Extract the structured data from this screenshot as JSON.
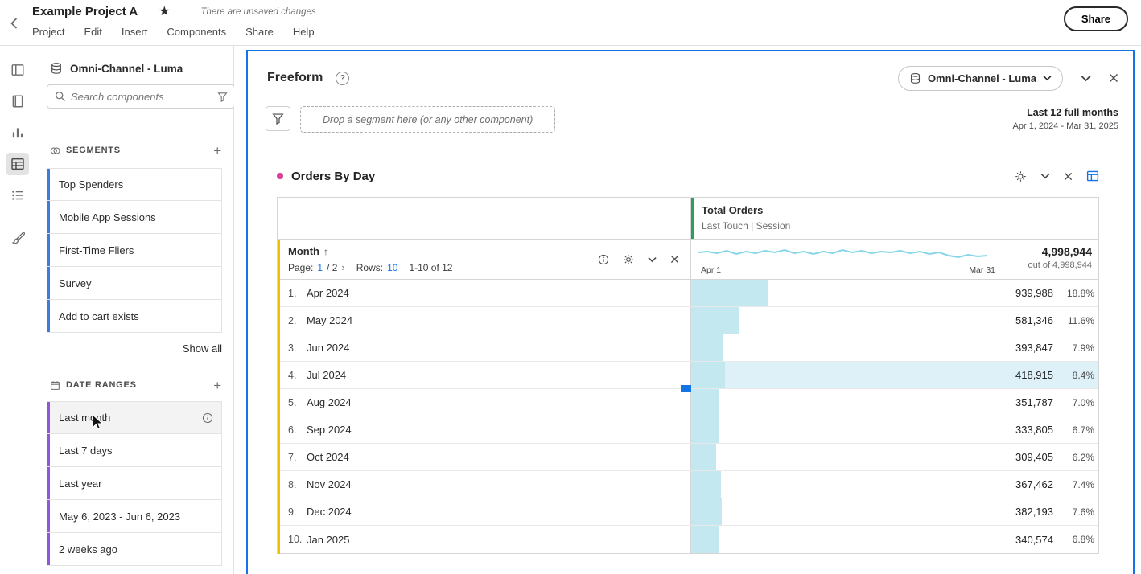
{
  "colors": {
    "accent_blue": "#1473e6",
    "segment": "#3c7dd9",
    "date_range": "#9256d9",
    "dimension": "#efc100",
    "metric": "#2aa05e",
    "bar": "#c3e8ef",
    "row_highlight": "#def0f8",
    "spark": "#86d6e6",
    "viz_dot": "#da3f9b"
  },
  "topbar": {
    "title": "Example Project A",
    "unsaved_notice": "There are unsaved changes",
    "menus": [
      "Project",
      "Edit",
      "Insert",
      "Components",
      "Share",
      "Help"
    ],
    "share_label": "Share"
  },
  "rail_icons": [
    "panels-icon",
    "components-book-icon",
    "visualizations-chart-icon",
    "freeform-table-icon",
    "components-list-icon",
    "design-brush-icon"
  ],
  "sidebar": {
    "dataset_name": "Omni-Channel - Luma",
    "search_placeholder": "Search components",
    "segments_label": "SEGMENTS",
    "segments": [
      "Top Spenders",
      "Mobile App Sessions",
      "First-Time Fliers",
      "Survey",
      "Add to cart exists"
    ],
    "show_all_label": "Show all",
    "date_ranges_label": "DATE RANGES",
    "date_ranges": [
      "Last month",
      "Last 7 days",
      "Last year",
      "May 6, 2023 - Jun 6, 2023",
      "2 weeks ago"
    ]
  },
  "panel": {
    "title": "Freeform",
    "help_label": "?",
    "dataset_name": "Omni-Channel - Luma",
    "dropzone_hint": "Drop a segment here (or any other component)",
    "date_range_label": "Last 12 full months",
    "date_range_dates": "Apr 1, 2024 - Mar 31, 2025"
  },
  "viz": {
    "title": "Orders By Day",
    "metric_name": "Total Orders",
    "metric_attribution": "Last Touch | Session",
    "dimension_name": "Month",
    "pagination": {
      "page_label": "Page:",
      "current_page": "1",
      "page_total": "/ 2",
      "rows_label": "Rows:",
      "rows_per_page": "10",
      "range": "1-10 of 12"
    },
    "spark_start_label": "Apr 1",
    "spark_end_label": "Mar 31",
    "grand_total": "4,998,944",
    "grand_total_note": "out of 4,998,944",
    "rows": [
      {
        "index": "1.",
        "month": "Apr 2024",
        "value": "939,988",
        "pct": "18.8%",
        "pct_num": 18.8
      },
      {
        "index": "2.",
        "month": "May 2024",
        "value": "581,346",
        "pct": "11.6%",
        "pct_num": 11.6
      },
      {
        "index": "3.",
        "month": "Jun 2024",
        "value": "393,847",
        "pct": "7.9%",
        "pct_num": 7.9
      },
      {
        "index": "4.",
        "month": "Jul 2024",
        "value": "418,915",
        "pct": "8.4%",
        "pct_num": 8.4,
        "highlight": true
      },
      {
        "index": "5.",
        "month": "Aug 2024",
        "value": "351,787",
        "pct": "7.0%",
        "pct_num": 7.0
      },
      {
        "index": "6.",
        "month": "Sep 2024",
        "value": "333,805",
        "pct": "6.7%",
        "pct_num": 6.7
      },
      {
        "index": "7.",
        "month": "Oct 2024",
        "value": "309,405",
        "pct": "6.2%",
        "pct_num": 6.2
      },
      {
        "index": "8.",
        "month": "Nov 2024",
        "value": "367,462",
        "pct": "7.4%",
        "pct_num": 7.4
      },
      {
        "index": "9.",
        "month": "Dec 2024",
        "value": "382,193",
        "pct": "7.6%",
        "pct_num": 7.6
      },
      {
        "index": "10.",
        "month": "Jan 2025",
        "value": "340,574",
        "pct": "6.8%",
        "pct_num": 6.8
      }
    ]
  }
}
